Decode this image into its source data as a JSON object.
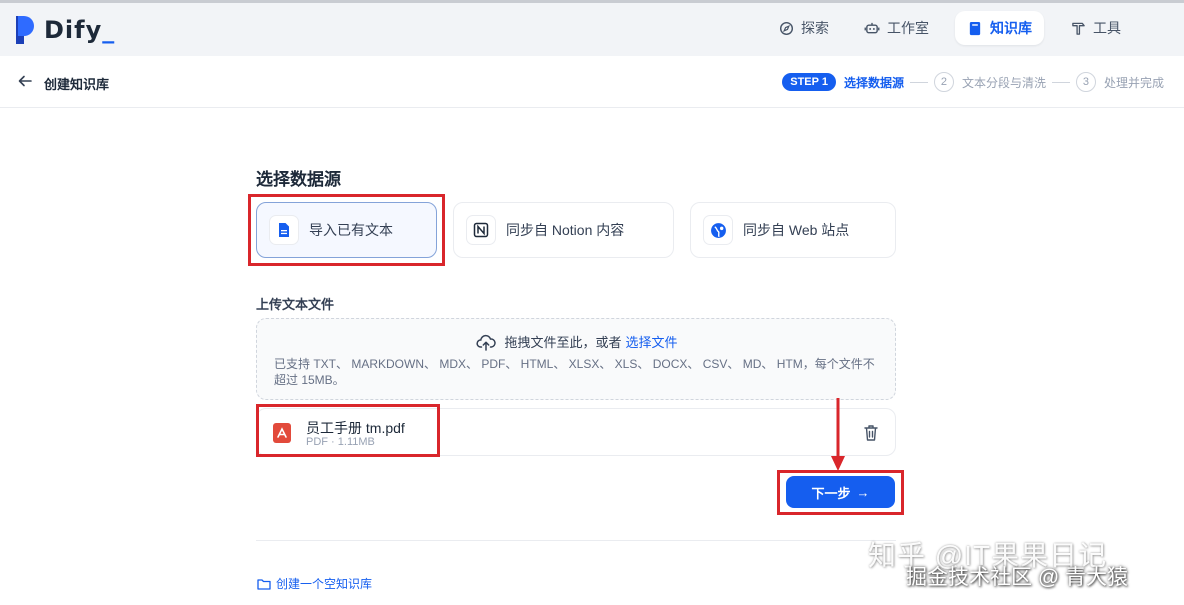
{
  "app": {
    "logo_text": "Dify",
    "logo_suffix": "_"
  },
  "nav": {
    "items": [
      {
        "label": "探索",
        "icon": "compass-icon"
      },
      {
        "label": "工作室",
        "icon": "robot-icon"
      },
      {
        "label": "知识库",
        "icon": "book-icon",
        "active": true
      },
      {
        "label": "工具",
        "icon": "hammer-icon"
      }
    ]
  },
  "header": {
    "title": "创建知识库",
    "steps": {
      "badge": "STEP 1",
      "step1": "选择数据源",
      "step2_num": "2",
      "step2": "文本分段与清洗",
      "step3_num": "3",
      "step3": "处理并完成"
    }
  },
  "datasource": {
    "title": "选择数据源",
    "options": [
      {
        "label": "导入已有文本",
        "icon": "file-text-icon",
        "selected": true
      },
      {
        "label": "同步自 Notion 内容",
        "icon": "notion-icon"
      },
      {
        "label": "同步自 Web 站点",
        "icon": "globe-icon"
      }
    ]
  },
  "upload": {
    "label": "上传文本文件",
    "drop_text": "拖拽文件至此，或者",
    "select_link": "选择文件",
    "hint": "已支持 TXT、 MARKDOWN、 MDX、 PDF、 HTML、 XLSX、 XLS、 DOCX、 CSV、 MD、 HTM，每个文件不超过 15MB。"
  },
  "file": {
    "name": "员工手册 tm.pdf",
    "meta": "PDF · 1.11MB"
  },
  "actions": {
    "next": "下一步",
    "next_arrow": "→",
    "create_empty": "创建一个空知识库"
  },
  "watermarks": {
    "line1": "知乎 @IT果果日记",
    "line2": "掘金技术社区 @ 青大猿"
  },
  "colors": {
    "accent": "#155eef",
    "annotation_red": "#d9262b"
  }
}
